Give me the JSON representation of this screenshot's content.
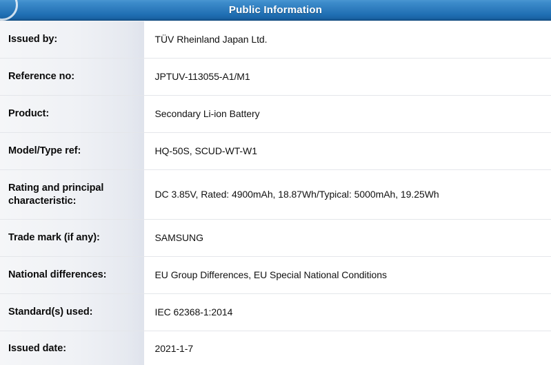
{
  "header": {
    "title": "Public Information",
    "icon": "circle-logo-mark",
    "bg_color_top": "#4a96d2",
    "bg_color_bottom": "#14528c",
    "text_color": "#ffffff"
  },
  "table": {
    "label_column_bg": "#eef0f4",
    "value_column_bg": "#ffffff",
    "rows": [
      {
        "label": "Issued by:",
        "value": "TÜV Rheinland Japan Ltd."
      },
      {
        "label": "Reference no:",
        "value": "JPTUV-113055-A1/M1"
      },
      {
        "label": "Product:",
        "value": "Secondary Li-ion Battery"
      },
      {
        "label": "Model/Type ref:",
        "value": "HQ-50S, SCUD-WT-W1"
      },
      {
        "label": "Rating and principal characteristic:",
        "value": "DC 3.85V, Rated: 4900mAh, 18.87Wh/Typical: 5000mAh, 19.25Wh"
      },
      {
        "label": "Trade mark (if any):",
        "value": "SAMSUNG"
      },
      {
        "label": "National differences:",
        "value": "EU Group Differences, EU Special National Conditions"
      },
      {
        "label": "Standard(s) used:",
        "value": "IEC 62368-1:2014"
      },
      {
        "label": "Issued date:",
        "value": "2021-1-7"
      }
    ]
  }
}
